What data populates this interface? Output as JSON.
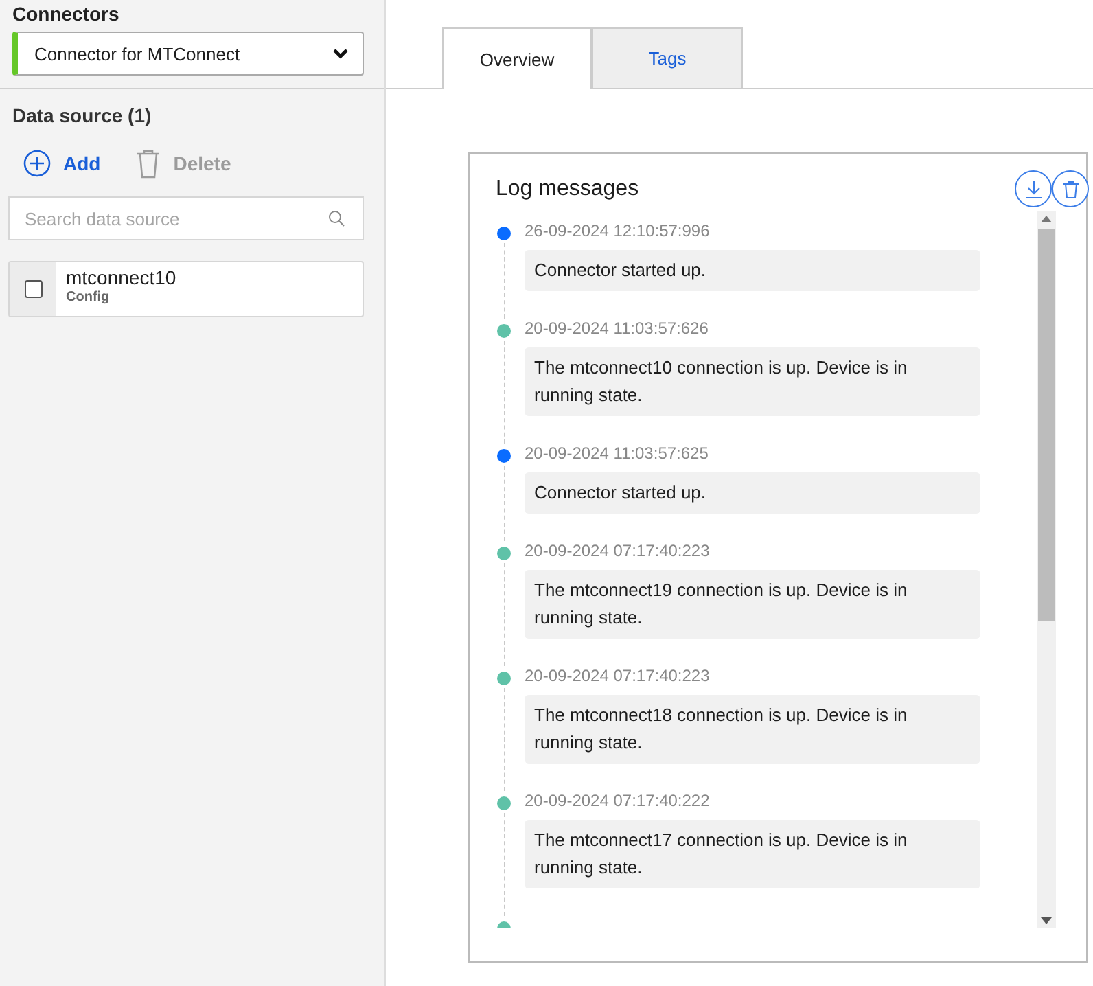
{
  "sidebar": {
    "connectors_label": "Connectors",
    "connector_select": {
      "value": "Connector for MTConnect",
      "color": "#65c728"
    },
    "data_source_title": "Data source (1)",
    "actions": [
      {
        "kind": "add",
        "label": "Add",
        "disabled": false
      },
      {
        "kind": "delete",
        "label": "Delete",
        "disabled": true
      }
    ],
    "search": {
      "placeholder": "Search data source"
    },
    "items": [
      {
        "name": "mtconnect10",
        "subtitle": "Config",
        "checked": false
      }
    ]
  },
  "tabs": [
    {
      "label": "Overview",
      "selected": true
    },
    {
      "label": "Tags",
      "selected": false
    }
  ],
  "log_panel": {
    "title": "Log messages",
    "entries": [
      {
        "time": "26-09-2024 12:10:57:996",
        "message": "Connector started up.",
        "color": "#0a6cff"
      },
      {
        "time": "20-09-2024 11:03:57:626",
        "message": "The mtconnect10 connection is up. Device is in running state.",
        "color": "#5fc2a8"
      },
      {
        "time": "20-09-2024 11:03:57:625",
        "message": "Connector started up.",
        "color": "#0a6cff"
      },
      {
        "time": "20-09-2024 07:17:40:223",
        "message": "The mtconnect19 connection is up. Device is in running state.",
        "color": "#5fc2a8"
      },
      {
        "time": "20-09-2024 07:17:40:223",
        "message": "The mtconnect18 connection is up. Device is in running state.",
        "color": "#5fc2a8"
      },
      {
        "time": "20-09-2024 07:17:40:222",
        "message": "The mtconnect17 connection is up. Device is in running state.",
        "color": "#5fc2a8"
      },
      {
        "color": "#5fc2a8"
      }
    ]
  }
}
